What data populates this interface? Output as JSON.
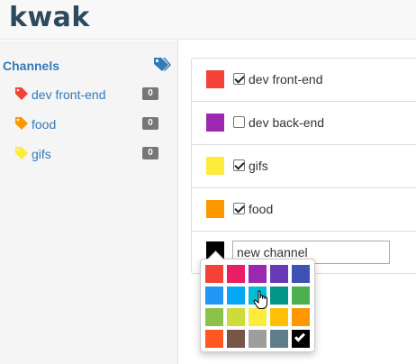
{
  "header": {
    "logo": "kwak"
  },
  "sidebar": {
    "title": "Channels",
    "title_icon": "tags-icon",
    "items": [
      {
        "label": "dev front-end",
        "count": "0",
        "color": "#f44336",
        "icon": "tag-icon"
      },
      {
        "label": "food",
        "count": "0",
        "color": "#ff9800",
        "icon": "tag-icon"
      },
      {
        "label": "gifs",
        "count": "0",
        "color": "#ffeb3b",
        "icon": "tag-icon"
      }
    ]
  },
  "channels": [
    {
      "label": "dev front-end",
      "color": "#f44336",
      "checked": true
    },
    {
      "label": "dev back-end",
      "color": "#9c27b0",
      "checked": false
    },
    {
      "label": "gifs",
      "color": "#ffeb3b",
      "checked": true
    },
    {
      "label": "food",
      "color": "#ff9800",
      "checked": true
    }
  ],
  "new_channel": {
    "value": "new channel",
    "icon": "bookmark-icon",
    "color": "#000000"
  },
  "color_picker": {
    "colors": [
      [
        "#f44336",
        "#e91e63",
        "#9c27b0",
        "#673ab7",
        "#3f51b5"
      ],
      [
        "#2196f3",
        "#03a9f4",
        "#00bcd4",
        "#009688",
        "#4caf50"
      ],
      [
        "#8bc34a",
        "#cddc39",
        "#ffeb3b",
        "#ffc107",
        "#ff9800"
      ],
      [
        "#ff5722",
        "#795548",
        "#9e9e9e",
        "#607d8b",
        "#000000"
      ]
    ],
    "selected": "#000000"
  }
}
